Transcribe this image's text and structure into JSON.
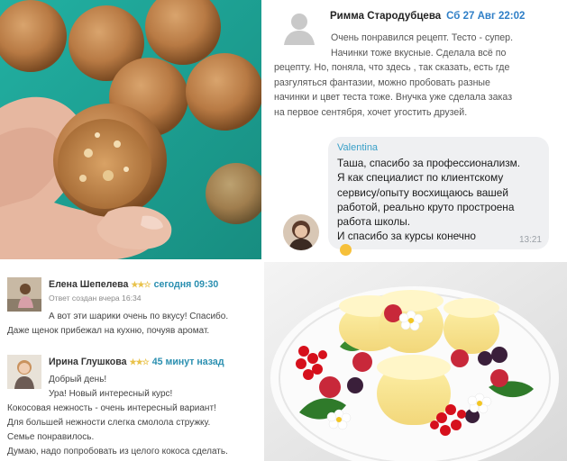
{
  "review": {
    "author": "Римма Стародубцева",
    "date": "Сб 27 Авг 22:02",
    "lines": [
      "Очень понравился рецепт. Тесто - супер.",
      "Начинки тоже вкусные. Сделала всё по",
      "рецепту. Но, поняла, что здесь , так сказать, есть где",
      "разгуляться фантазии, можно пробовать разные",
      "начинки и цвет теста тоже. Внучка уже сделала заказ",
      "на первое сентября, хочет угостить друзей."
    ]
  },
  "reply": {
    "author": "Valentina",
    "lines": [
      "Таша, спасибо за профессионализм.",
      "Я как специалист по клиентскому",
      "сервису/опыту восхищаюсь вашей",
      "работой, реально круто простроена",
      "работа школы.",
      "И спасибо за курсы конечно"
    ],
    "time": "13:21"
  },
  "comments": [
    {
      "author": "Елена Шепелева",
      "stars": "★★☆",
      "when": "сегодня 09:30",
      "sub": "Ответ создан вчера 16:34",
      "lines": [
        "А вот эти шарики очень по вкусу! Спасибо.",
        "Даже щенок прибежал на кухню, почуяв аромат."
      ]
    },
    {
      "author": "Ирина Глушкова",
      "stars": "★★☆",
      "when": "45 минут назад",
      "lines": [
        "Добрый день!",
        "Ура! Новый интересный курс!",
        "Кокосовая нежность - очень интересный вариант!",
        "Для большей нежности слегка смолола стружку.",
        "Семье понравилось.",
        "Думаю, надо попробовать из целого кокоса сделать."
      ]
    }
  ],
  "colors": {
    "photo_background": "#1fa89a",
    "date_blue": "#2f7fc7",
    "reply_author": "#3aa0c8",
    "comment_time": "#2a8fb0",
    "bubble_background": "#eff0f2"
  }
}
